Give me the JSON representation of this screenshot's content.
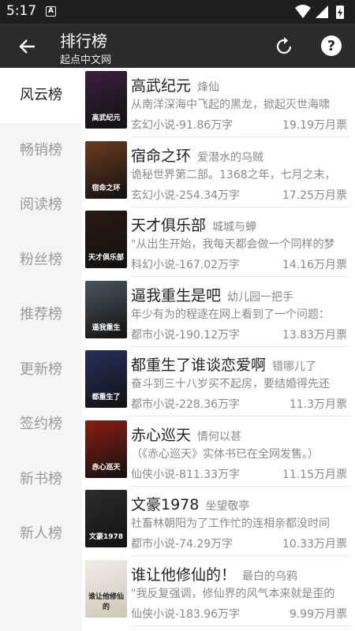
{
  "status_bar": {
    "time": "5:17",
    "notif_letter": "A"
  },
  "app_bar": {
    "title": "排行榜",
    "subtitle": "起点中文网"
  },
  "tabs": [
    "风云榜",
    "畅销榜",
    "阅读榜",
    "粉丝榜",
    "推荐榜",
    "更新榜",
    "签约榜",
    "新书榜",
    "新人榜"
  ],
  "active_tab": 0,
  "books": [
    {
      "title": "高武纪元",
      "author": "烽仙",
      "desc": "从南洋深海中飞起的黑龙，掀起灭世海啸",
      "meta": "玄幻小说-91.86万字",
      "votes": "19.19万月票",
      "cover_text": "高武纪元",
      "cover_color": "#3a1e3e"
    },
    {
      "title": "宿命之环",
      "author": "爱潜水的乌贼",
      "desc": "诡秘世界第二部。1368之年，七月之末，",
      "meta": "玄幻小说-254.34万字",
      "votes": "17.25万月票",
      "cover_text": "宿命之环",
      "cover_color": "#6b3b1f"
    },
    {
      "title": "天才俱乐部",
      "author": "城城与蝉",
      "desc": "\"从出生开始，我每天都会做一个同样的梦",
      "meta": "科幻小说-167.02万字",
      "votes": "14.16万月票",
      "cover_text": "天才俱乐部",
      "cover_color": "#2a1a10"
    },
    {
      "title": "逼我重生是吧",
      "author": "幼儿园一把手",
      "desc": "年少有为的程逐在网上看到了一个问题：",
      "meta": "都市小说-190.12万字",
      "votes": "13.83万月票",
      "cover_text": "逼我重生",
      "cover_color": "#4a5560"
    },
    {
      "title": "都重生了谁谈恋爱啊",
      "author": "错哪儿了",
      "desc": "奋斗到三十八岁买不起房，要结婚得先还",
      "meta": "都市小说-228.36万字",
      "votes": "11.3万月票",
      "cover_text": "都重生了",
      "cover_color": "#24305e"
    },
    {
      "title": "赤心巡天",
      "author": "情何以甚",
      "desc": "（《赤心巡天》实体书已在全网发售。）",
      "meta": "仙侠小说-811.33万字",
      "votes": "11.15万月票",
      "cover_text": "赤心巡天",
      "cover_color": "#8a1d12"
    },
    {
      "title": "文豪1978",
      "author": "坐望敬亭",
      "desc": "社畜林朝阳为了工作忙的连相亲都没时间",
      "meta": "都市小说-74.29万字",
      "votes": "10.33万月票",
      "cover_text": "文豪1978",
      "cover_color": "#2c2c2c"
    },
    {
      "title": "谁让他修仙的！",
      "author": "最白的乌鸦",
      "desc": "\"我反复强调，修仙界的风气本来就是歪的",
      "meta": "仙侠小说-183.96万字",
      "votes": "9.99万月票",
      "cover_text": "谁让他修仙的",
      "cover_color": "#e9e2d6"
    }
  ]
}
